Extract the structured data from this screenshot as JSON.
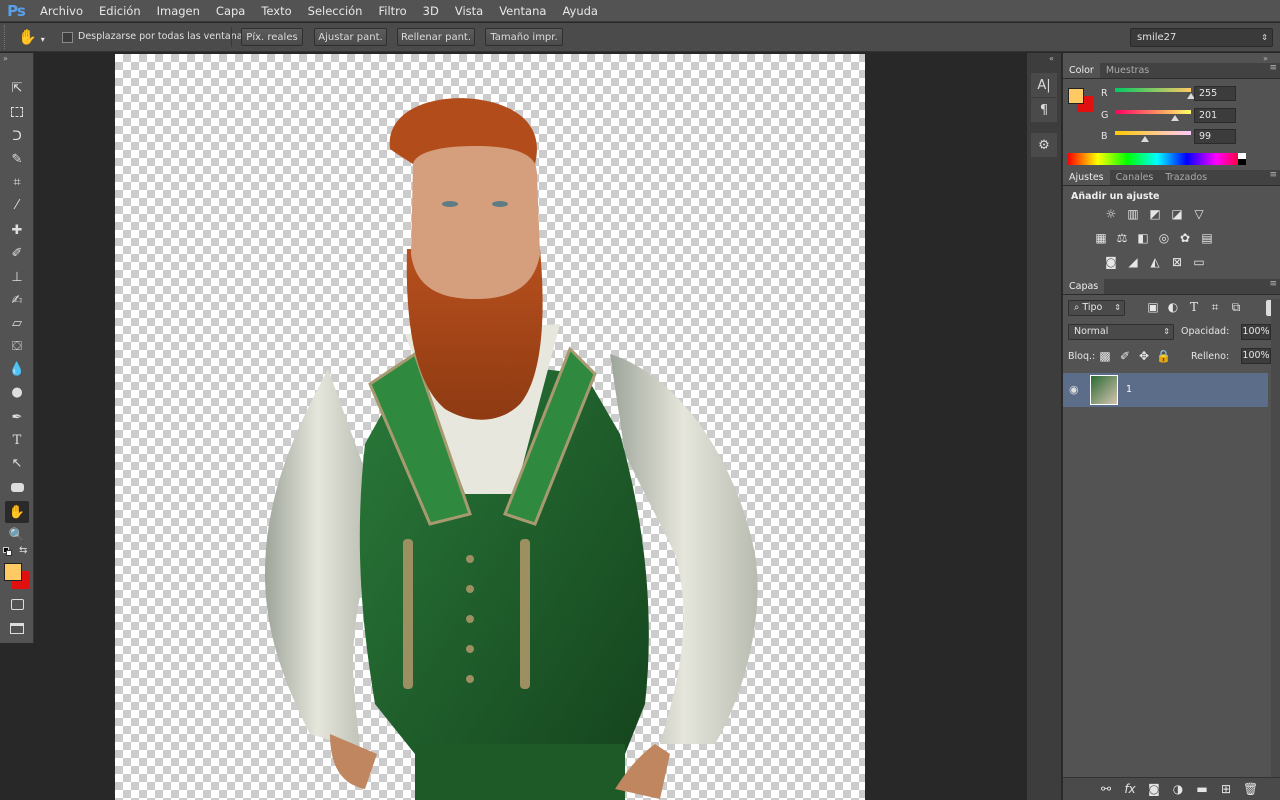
{
  "app": {
    "logo": "Ps"
  },
  "menu": [
    "Archivo",
    "Edición",
    "Imagen",
    "Capa",
    "Texto",
    "Selección",
    "Filtro",
    "3D",
    "Vista",
    "Ventana",
    "Ayuda"
  ],
  "options": {
    "scroll_all_label": "Desplazarse por todas las ventanas",
    "buttons": [
      "Píx. reales",
      "Ajustar pant.",
      "Rellenar pant.",
      "Tamaño impr."
    ],
    "workspace": "smile27"
  },
  "tools": [
    "move-icon",
    "marquee-icon",
    "lasso-icon",
    "quick-select-icon",
    "crop-icon",
    "eyedropper-icon",
    "healing-icon",
    "brush-icon",
    "stamp-icon",
    "history-brush-icon",
    "eraser-icon",
    "bucket-icon",
    "blur-icon",
    "dodge-icon",
    "pen-icon",
    "type-icon",
    "path-select-icon",
    "shape-icon",
    "hand-icon",
    "zoom-icon"
  ],
  "colors": {
    "foreground": "#ffc963",
    "background": "#e01010",
    "accent": "#5aa0e8"
  },
  "color_panel": {
    "tabs": [
      "Color",
      "Muestras"
    ],
    "channels": [
      {
        "label": "R",
        "value": "255",
        "fraction": 1.0
      },
      {
        "label": "G",
        "value": "201",
        "fraction": 0.79
      },
      {
        "label": "B",
        "value": "99",
        "fraction": 0.39
      }
    ]
  },
  "adjust_panel": {
    "tabs": [
      "Ajustes",
      "Canales",
      "Trazados"
    ],
    "heading": "Añadir un ajuste"
  },
  "layers_panel": {
    "tab": "Capas",
    "filter": "Tipo",
    "blend_mode": "Normal",
    "opacity_label": "Opacidad:",
    "opacity": "100%",
    "lock_label": "Bloq.:",
    "fill_label": "Relleno:",
    "fill": "100%",
    "layers": [
      {
        "name": "1"
      }
    ]
  }
}
